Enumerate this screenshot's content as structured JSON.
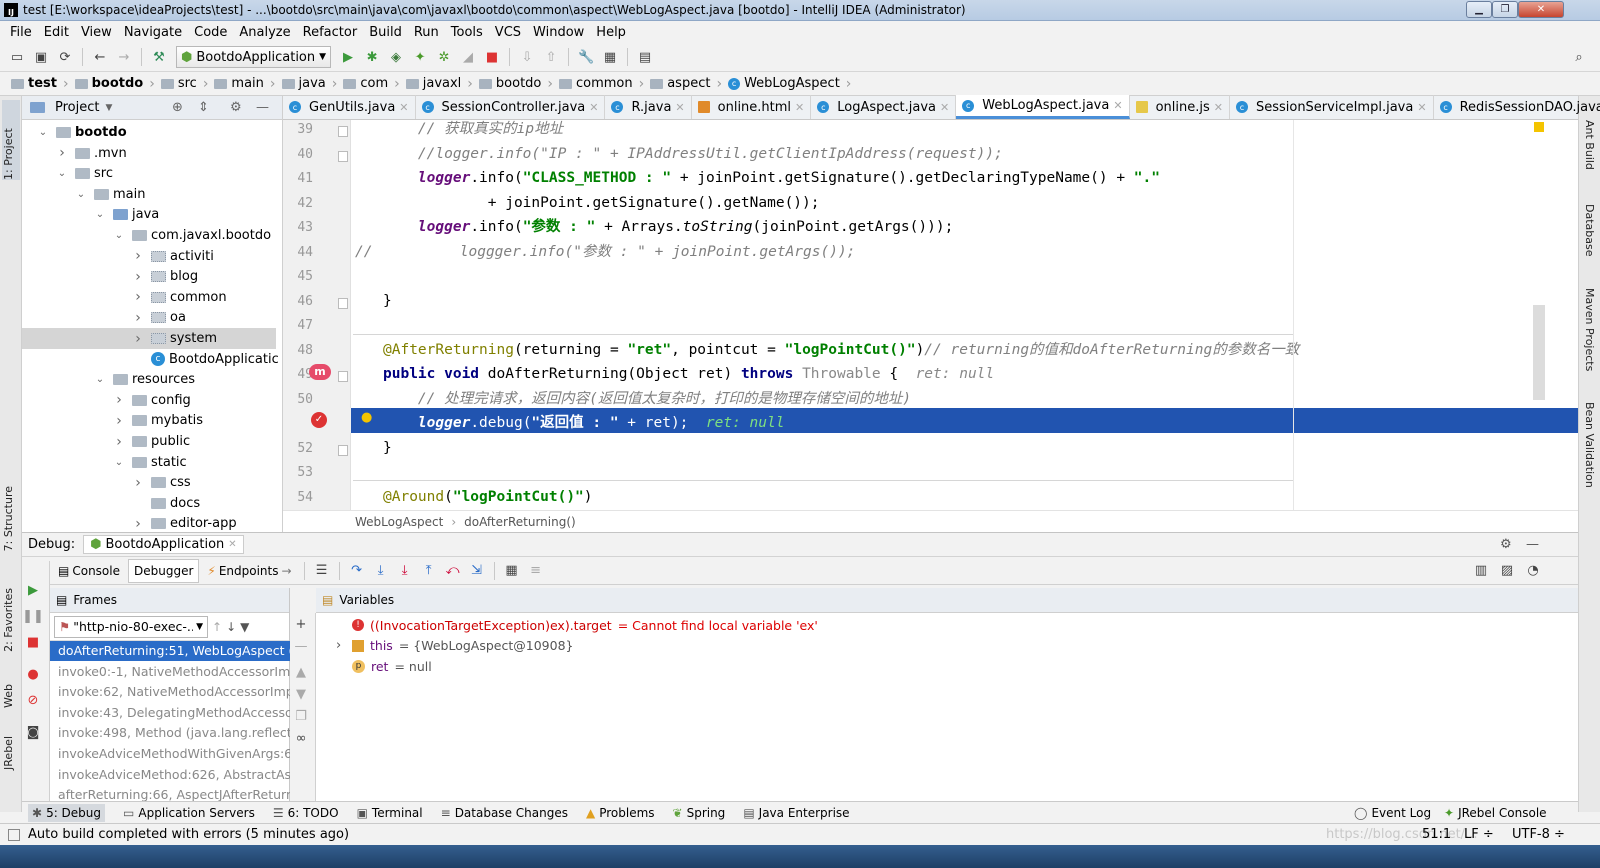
{
  "window": {
    "title": "test [E:\\workspace\\ideaProjects\\test] - ...\\bootdo\\src\\main\\java\\com\\javaxl\\bootdo\\common\\aspect\\WebLogAspect.java [bootdo] - IntelliJ IDEA (Administrator)",
    "logo": "IJ"
  },
  "menu": [
    "File",
    "Edit",
    "View",
    "Navigate",
    "Code",
    "Analyze",
    "Refactor",
    "Build",
    "Run",
    "Tools",
    "VCS",
    "Window",
    "Help"
  ],
  "toolbar": {
    "run_config": "BootdoApplication"
  },
  "breadcrumb": [
    "test",
    "bootdo",
    "src",
    "main",
    "java",
    "com",
    "javaxl",
    "bootdo",
    "common",
    "aspect",
    "WebLogAspect"
  ],
  "left_strip": {
    "project": "1: Project",
    "structure": "7: Structure",
    "favorites": "2: Favorites",
    "web": "Web",
    "jrebel": "JRebel"
  },
  "right_strip": {
    "ant": "Ant Build",
    "database": "Database",
    "maven": "Maven Projects",
    "bean": "Bean Validation"
  },
  "project": {
    "header": "Project",
    "tree": [
      {
        "label": "bootdo",
        "indent": 0,
        "open": true,
        "bold": true
      },
      {
        "label": ".mvn",
        "indent": 1,
        "open": false
      },
      {
        "label": "src",
        "indent": 1,
        "open": true
      },
      {
        "label": "main",
        "indent": 2,
        "open": true
      },
      {
        "label": "java",
        "indent": 3,
        "open": true
      },
      {
        "label": "com.javaxl.bootdo",
        "indent": 4,
        "open": true
      },
      {
        "label": "activiti",
        "indent": 5,
        "open": false
      },
      {
        "label": "blog",
        "indent": 5,
        "open": false
      },
      {
        "label": "common",
        "indent": 5,
        "open": false
      },
      {
        "label": "oa",
        "indent": 5,
        "open": false
      },
      {
        "label": "system",
        "indent": 5,
        "open": false,
        "selected": true
      },
      {
        "label": "BootdoApplicatic",
        "indent": 5,
        "class": true
      },
      {
        "label": "resources",
        "indent": 3,
        "open": true
      },
      {
        "label": "config",
        "indent": 4,
        "open": false
      },
      {
        "label": "mybatis",
        "indent": 4,
        "open": false
      },
      {
        "label": "public",
        "indent": 4,
        "open": false
      },
      {
        "label": "static",
        "indent": 4,
        "open": true
      },
      {
        "label": "css",
        "indent": 5,
        "open": false
      },
      {
        "label": "docs",
        "indent": 5,
        "leaf": true
      },
      {
        "label": "editor-app",
        "indent": 5,
        "open": false
      }
    ]
  },
  "tabs": [
    {
      "label": "GenUtils.java",
      "active": false
    },
    {
      "label": "SessionController.java",
      "active": false
    },
    {
      "label": "R.java",
      "active": false
    },
    {
      "label": "online.html",
      "active": false
    },
    {
      "label": "LogAspect.java",
      "active": false
    },
    {
      "label": "WebLogAspect.java",
      "active": true
    },
    {
      "label": "online.js",
      "active": false
    },
    {
      "label": "SessionServiceImpl.java",
      "active": false
    },
    {
      "label": "RedisSessionDAO.java",
      "active": false
    }
  ],
  "editor": {
    "line_numbers": [
      "39",
      "40",
      "41",
      "42",
      "43",
      "44",
      "45",
      "46",
      "47",
      "48",
      "49",
      "50",
      "51",
      "52",
      "53",
      "54"
    ],
    "current_line": "51",
    "breadcrumb": [
      "WebLogAspect",
      "doAfterReturning()"
    ]
  },
  "debug": {
    "label": "Debug:",
    "config": "BootdoApplication",
    "tabs": [
      "Console",
      "Debugger",
      "Endpoints"
    ],
    "frames_header": "Frames",
    "thread": "\"http-nio-80-exec-...",
    "frames": [
      {
        "text": "doAfterReturning:51, WebLogAspect (co",
        "selected": true
      },
      {
        "text": "invoke0:-1, NativeMethodAccessorImpl (",
        "selected": false
      },
      {
        "text": "invoke:62, NativeMethodAccessorImpl (s",
        "selected": false
      },
      {
        "text": "invoke:43, DelegatingMethodAccessorIm",
        "selected": false
      },
      {
        "text": "invoke:498, Method (java.lang.reflect)",
        "selected": false
      },
      {
        "text": "invokeAdviceMethodWithGivenArgs:644,",
        "selected": false
      },
      {
        "text": "invokeAdviceMethod:626, AbstractAspec",
        "selected": false
      },
      {
        "text": "afterReturning:66, AspectJAfterReturnin",
        "selected": false
      }
    ],
    "variables_header": "Variables",
    "variables": [
      {
        "name": "((InvocationTargetException)ex).target",
        "value": "= Cannot find local variable 'ex'",
        "error": true
      },
      {
        "name": "this",
        "value": "= {WebLogAspect@10908}",
        "error": false
      },
      {
        "name": "ret",
        "value": "= null",
        "error": false
      }
    ]
  },
  "bottom_tools": [
    "5: Debug",
    "Application Servers",
    "6: TODO",
    "Terminal",
    "Database Changes",
    "Problems",
    "Spring",
    "Java Enterprise"
  ],
  "bottom_tools_right": [
    "Event Log",
    "JRebel Console"
  ],
  "status": {
    "message": "Auto build completed with errors (5 minutes ago)",
    "position": "51:1",
    "line_sep": "LF ÷",
    "encoding": "UTF-8 ÷",
    "watermark": "https://blog.csdn.net/..."
  }
}
